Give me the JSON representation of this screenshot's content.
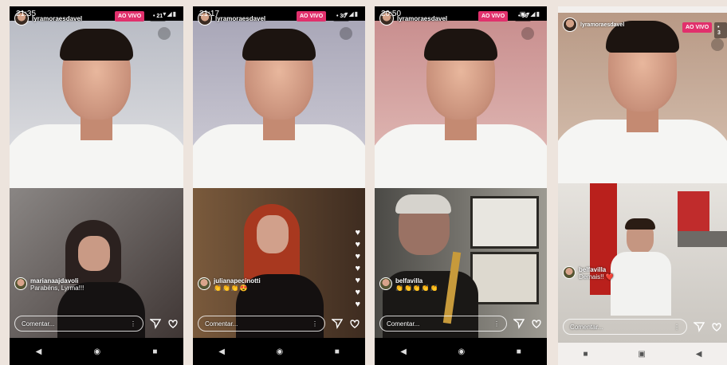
{
  "phones": [
    {
      "time": "21:35",
      "host": "lyramoraesdavel",
      "live_label": "AO VIVO",
      "viewers": "• 21",
      "comment_user": "marianaajdavoli",
      "comment_text": "Parabéns, Lyrma!!!",
      "comment_placeholder": "Comentar...",
      "colors": {
        "top_bg": "#cfd2d8",
        "bottom_bg": "#5b514d"
      }
    },
    {
      "time": "21:17",
      "host": "lyramoraesdavel",
      "live_label": "AO VIVO",
      "viewers": "• 30",
      "comment_user": "julianapecinotti",
      "comment_text": "👏👏👏😍",
      "comment_placeholder": "Comentar...",
      "colors": {
        "top_bg": "#b9b7c6",
        "bottom_bg": "#5b4331"
      }
    },
    {
      "time": "20:50",
      "host": "lyramoraesdavel",
      "live_label": "AO VIVO",
      "viewers": "• 36",
      "comment_user": "belfavilla",
      "comment_text": "👏👏👏👏👏",
      "comment_placeholder": "Comentar...",
      "colors": {
        "top_bg": "#d8a6a3",
        "bottom_bg": "#6b6862"
      }
    },
    {
      "time": "",
      "host": "lyramoraesdavel",
      "live_label": "AO VIVO",
      "viewers": "• 3",
      "comment_user": "belfavilla",
      "comment_text": "Demais!! ❤️",
      "comment_placeholder": "Comentar...",
      "colors": {
        "top_bg": "#c7aa96",
        "bottom_bg": "#d8d6d2"
      }
    }
  ]
}
